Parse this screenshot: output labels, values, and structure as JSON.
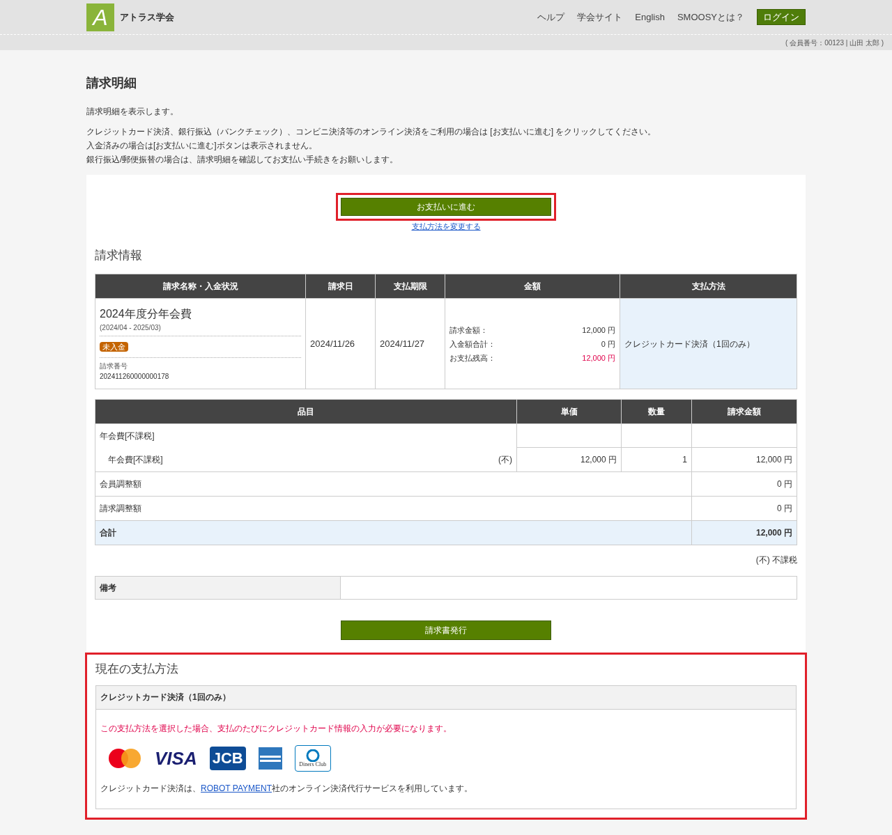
{
  "header": {
    "logo_letter": "A",
    "site_name": "アトラス学会",
    "nav": [
      "ヘルプ",
      "学会サイト",
      "English",
      "SMOOSYとは？"
    ],
    "login": "ログイン",
    "member_info": "( 会員番号：00123 | 山田 太郎 )"
  },
  "page": {
    "title": "請求明細",
    "intro": "請求明細を表示します。",
    "notes": [
      "クレジットカード決済、銀行振込（バンクチェック）、コンビニ決済等のオンライン決済をご利用の場合は [お支払いに進む] をクリックしてください。",
      "入金済みの場合は[お支払いに進む]ボタンは表示されません。",
      "銀行振込/郵便振替の場合は、請求明細を確認してお支払い手続きをお願いします。"
    ]
  },
  "pay_button": {
    "label": "お支払いに進む",
    "highlighted": true
  },
  "change_method_link": "支払方法を変更する",
  "billing_info": {
    "heading": "請求情報",
    "columns": [
      "請求名称・入金状況",
      "請求日",
      "支払期限",
      "金額",
      "支払方法"
    ],
    "row": {
      "name": "2024年度分年会費",
      "period": "(2024/04 - 2025/03)",
      "status": "未入金",
      "invoice_no_label": "請求番号",
      "invoice_no": "202411260000000178",
      "billing_date": "2024/11/26",
      "due_date": "2024/11/27",
      "amounts": [
        {
          "label": "請求金額：",
          "value": "12,000 円",
          "alert": false
        },
        {
          "label": "入金額合計：",
          "value": "0 円",
          "alert": false
        },
        {
          "label": "お支払残高：",
          "value": "12,000 円",
          "alert": true
        }
      ],
      "method": "クレジットカード決済（1回のみ）"
    }
  },
  "items": {
    "columns": [
      "品目",
      "単価",
      "数量",
      "請求金額"
    ],
    "rows": [
      {
        "kind": "group",
        "name": "年会費[不課税]"
      },
      {
        "kind": "item",
        "name": "年会費[不課税]",
        "tax": "(不)",
        "unit_price": "12,000 円",
        "quantity": "1",
        "amount": "12,000 円"
      },
      {
        "kind": "adjust",
        "name": "会員調整額",
        "amount": "0 円"
      },
      {
        "kind": "adjust",
        "name": "請求調整額",
        "amount": "0 円"
      },
      {
        "kind": "total",
        "name": "合計",
        "amount": "12,000 円"
      }
    ],
    "tax_note": "(不) 不課税",
    "remarks_label": "備考"
  },
  "invoice_button": "請求書発行",
  "current_method": {
    "highlighted": true,
    "heading": "現在の支払方法",
    "method": "クレジットカード決済（1回のみ）",
    "warning": "この支払方法を選択した場合、支払のたびにクレジットカード情報の入力が必要になります。",
    "cards": [
      {
        "kind": "mastercard"
      },
      {
        "kind": "visa",
        "label": "VISA"
      },
      {
        "kind": "jcb",
        "label": "JCB"
      },
      {
        "kind": "amex"
      },
      {
        "kind": "diners",
        "label": "Diners Club"
      }
    ],
    "provider_before": "クレジットカード決済は、",
    "provider_link": "ROBOT PAYMENT",
    "provider_after": "社のオンライン決済代行サービスを利用しています。"
  }
}
